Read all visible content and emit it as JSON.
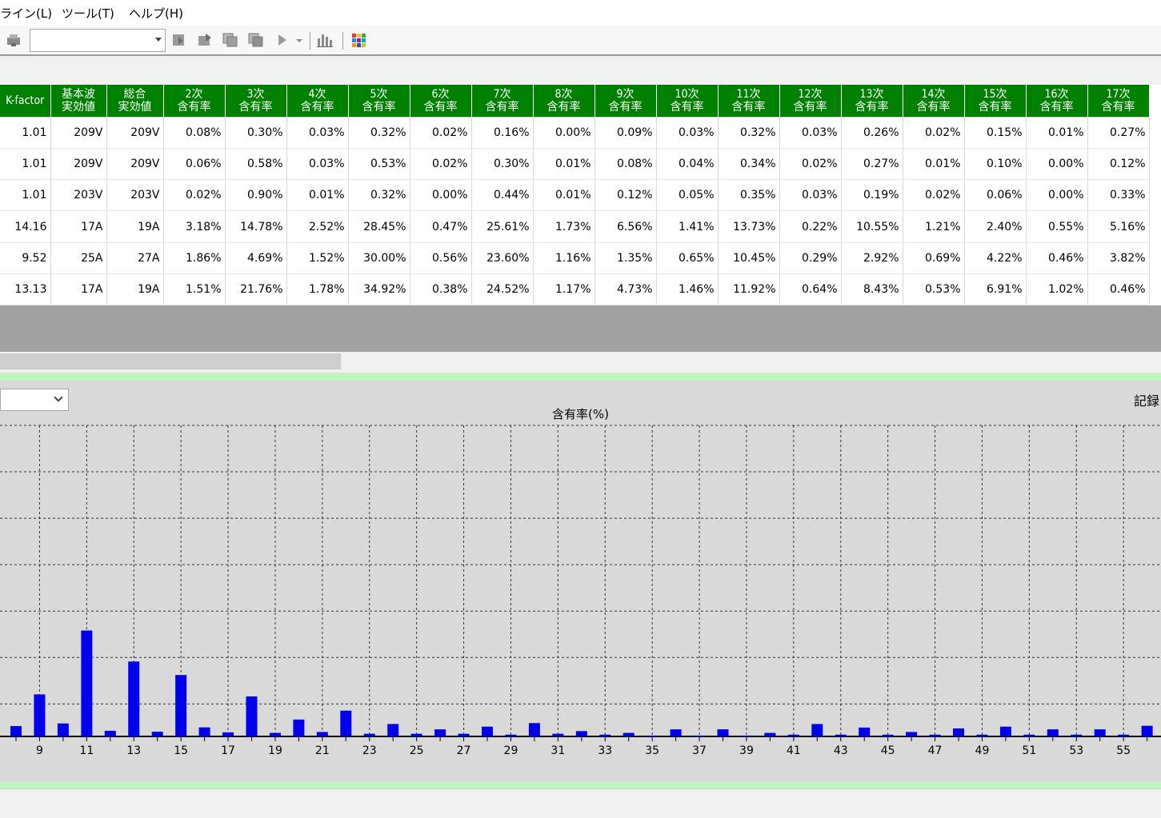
{
  "menu": [
    "ライン(L)",
    "ツール(T)",
    "ヘルプ(H)"
  ],
  "toolbar": {
    "combo_value": "",
    "palette_colors": [
      "#e53935",
      "#fbc02d",
      "#43a047",
      "#1e88e5",
      "#8e24aa",
      "#00acc1",
      "#fb8c00",
      "#3949ab",
      "#c0ca33"
    ]
  },
  "table": {
    "headers": [
      "K-factor",
      "基本波\n実効値",
      "総合\n実効値",
      "2次\n含有率",
      "3次\n含有率",
      "4次\n含有率",
      "5次\n含有率",
      "6次\n含有率",
      "7次\n含有率",
      "8次\n含有率",
      "9次\n含有率",
      "10次\n含有率",
      "11次\n含有率",
      "12次\n含有率",
      "13次\n含有率",
      "14次\n含有率",
      "15次\n含有率",
      "16次\n含有率",
      "17次\n含有率"
    ],
    "rows": [
      [
        "1.01",
        "209V",
        "209V",
        "0.08%",
        "0.30%",
        "0.03%",
        "0.32%",
        "0.02%",
        "0.16%",
        "0.00%",
        "0.09%",
        "0.03%",
        "0.32%",
        "0.03%",
        "0.26%",
        "0.02%",
        "0.15%",
        "0.01%",
        "0.27%"
      ],
      [
        "1.01",
        "209V",
        "209V",
        "0.06%",
        "0.58%",
        "0.03%",
        "0.53%",
        "0.02%",
        "0.30%",
        "0.01%",
        "0.08%",
        "0.04%",
        "0.34%",
        "0.02%",
        "0.27%",
        "0.01%",
        "0.10%",
        "0.00%",
        "0.12%"
      ],
      [
        "1.01",
        "203V",
        "203V",
        "0.02%",
        "0.90%",
        "0.01%",
        "0.32%",
        "0.00%",
        "0.44%",
        "0.01%",
        "0.12%",
        "0.05%",
        "0.35%",
        "0.03%",
        "0.19%",
        "0.02%",
        "0.06%",
        "0.00%",
        "0.33%"
      ],
      [
        "14.16",
        "17A",
        "19A",
        "3.18%",
        "14.78%",
        "2.52%",
        "28.45%",
        "0.47%",
        "25.61%",
        "1.73%",
        "6.56%",
        "1.41%",
        "13.73%",
        "0.22%",
        "10.55%",
        "1.21%",
        "2.40%",
        "0.55%",
        "5.16%"
      ],
      [
        "9.52",
        "25A",
        "27A",
        "1.86%",
        "4.69%",
        "1.52%",
        "30.00%",
        "0.56%",
        "23.60%",
        "1.16%",
        "1.35%",
        "0.65%",
        "10.45%",
        "0.29%",
        "2.92%",
        "0.69%",
        "4.22%",
        "0.46%",
        "3.82%"
      ],
      [
        "13.13",
        "17A",
        "19A",
        "1.51%",
        "21.76%",
        "1.78%",
        "34.92%",
        "0.38%",
        "24.52%",
        "1.17%",
        "4.73%",
        "1.46%",
        "11.92%",
        "0.64%",
        "8.43%",
        "0.53%",
        "6.91%",
        "1.02%",
        "0.46%"
      ]
    ]
  },
  "chart_panel": {
    "record_label": "記録",
    "combo_value": ""
  },
  "chart_data": {
    "type": "bar",
    "title": "含有率(%)",
    "xlabel": "",
    "ylabel": "",
    "x_tick_labels": [
      "9",
      "11",
      "13",
      "15",
      "17",
      "19",
      "21",
      "23",
      "25",
      "27",
      "29",
      "31",
      "33",
      "35",
      "37",
      "39",
      "41",
      "43",
      "45",
      "47",
      "49",
      "51",
      "53",
      "55"
    ],
    "categories": [
      8,
      9,
      10,
      11,
      12,
      13,
      14,
      15,
      16,
      17,
      18,
      19,
      20,
      21,
      22,
      23,
      24,
      25,
      26,
      27,
      28,
      29,
      30,
      31,
      32,
      33,
      34,
      35,
      36,
      37,
      38,
      39,
      40,
      41,
      42,
      43,
      44,
      45,
      46,
      47,
      48,
      49,
      50,
      51,
      52,
      53,
      54,
      55,
      56
    ],
    "values": [
      1.17,
      4.73,
      1.46,
      11.92,
      0.64,
      8.43,
      0.53,
      6.91,
      1.02,
      0.46,
      4.5,
      0.4,
      1.9,
      0.5,
      2.9,
      0.3,
      1.4,
      0.3,
      0.8,
      0.3,
      1.1,
      0.2,
      1.5,
      0.3,
      0.6,
      0.2,
      0.4,
      0.1,
      0.8,
      0.1,
      0.8,
      0.1,
      0.4,
      0.2,
      1.4,
      0.2,
      1.0,
      0.2,
      0.5,
      0.2,
      0.9,
      0.2,
      1.1,
      0.2,
      0.8,
      0.2,
      0.8,
      0.2,
      1.2
    ],
    "ylim": [
      0,
      35
    ],
    "grid": true,
    "bar_color": "#0000ee"
  }
}
